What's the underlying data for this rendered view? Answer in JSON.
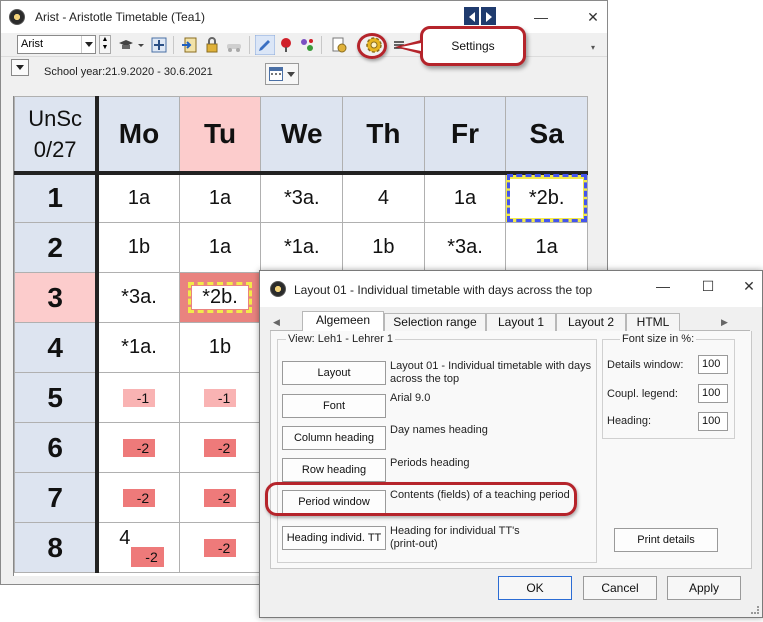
{
  "app_window": {
    "title": "Arist - Aristotle  Timetable  (Tea1)",
    "teacher_select_value": "Arist",
    "school_year": "School year:21.9.2020 - 30.6.2021"
  },
  "callout": {
    "label": "Settings"
  },
  "timetable": {
    "corner_line1": "UnSc",
    "corner_line2": "0/27",
    "days": [
      "Mo",
      "Tu",
      "We",
      "Th",
      "Fr",
      "Sa"
    ],
    "periods": [
      "1",
      "2",
      "3",
      "4",
      "5",
      "6",
      "7",
      "8"
    ],
    "rows": [
      [
        "1a",
        "1a",
        "*3a.",
        "4",
        "1a",
        "*2b."
      ],
      [
        "1b",
        "1a",
        "*1a.",
        "1b",
        "*3a.",
        "1a"
      ],
      [
        "*3a.",
        "*2b.",
        "",
        "",
        "",
        ""
      ],
      [
        "*1a.",
        "1b",
        "",
        "",
        "",
        ""
      ],
      [
        "-1",
        "-1",
        "",
        "",
        "",
        ""
      ],
      [
        "-2",
        "-2",
        "",
        "",
        "",
        ""
      ],
      [
        "-2",
        "-2",
        "",
        "",
        "",
        ""
      ],
      [
        "4",
        "-2",
        "",
        "",
        "",
        ""
      ]
    ],
    "row8_sub": "-2"
  },
  "dialog": {
    "title": "Layout 01 - Individual timetable with days across the top",
    "tabs": [
      "Algemeen",
      "Selection range",
      "Layout 1",
      "Layout 2",
      "HTML"
    ],
    "view_label": "View: Leh1 - Lehrer 1",
    "rows": [
      {
        "button": "Layout",
        "desc": "Layout 01 - Individual timetable with days across the top"
      },
      {
        "button": "Font",
        "desc": "Arial 9.0"
      },
      {
        "button": "Column heading",
        "desc": "Day names heading"
      },
      {
        "button": "Row heading",
        "desc": "Periods heading"
      },
      {
        "button": "Period window",
        "desc": "Contents (fields) of a teaching period"
      },
      {
        "button": "Heading individ. TT",
        "desc": "Heading for individual TT's (print-out)"
      }
    ],
    "font_size": {
      "group_label": "Font size in %:",
      "details_label": "Details window:",
      "details_value": "100",
      "legend_label": "Coupl. legend:",
      "legend_value": "100",
      "heading_label": "Heading:",
      "heading_value": "100"
    },
    "print_details": "Print details",
    "ok": "OK",
    "cancel": "Cancel",
    "apply": "Apply"
  }
}
